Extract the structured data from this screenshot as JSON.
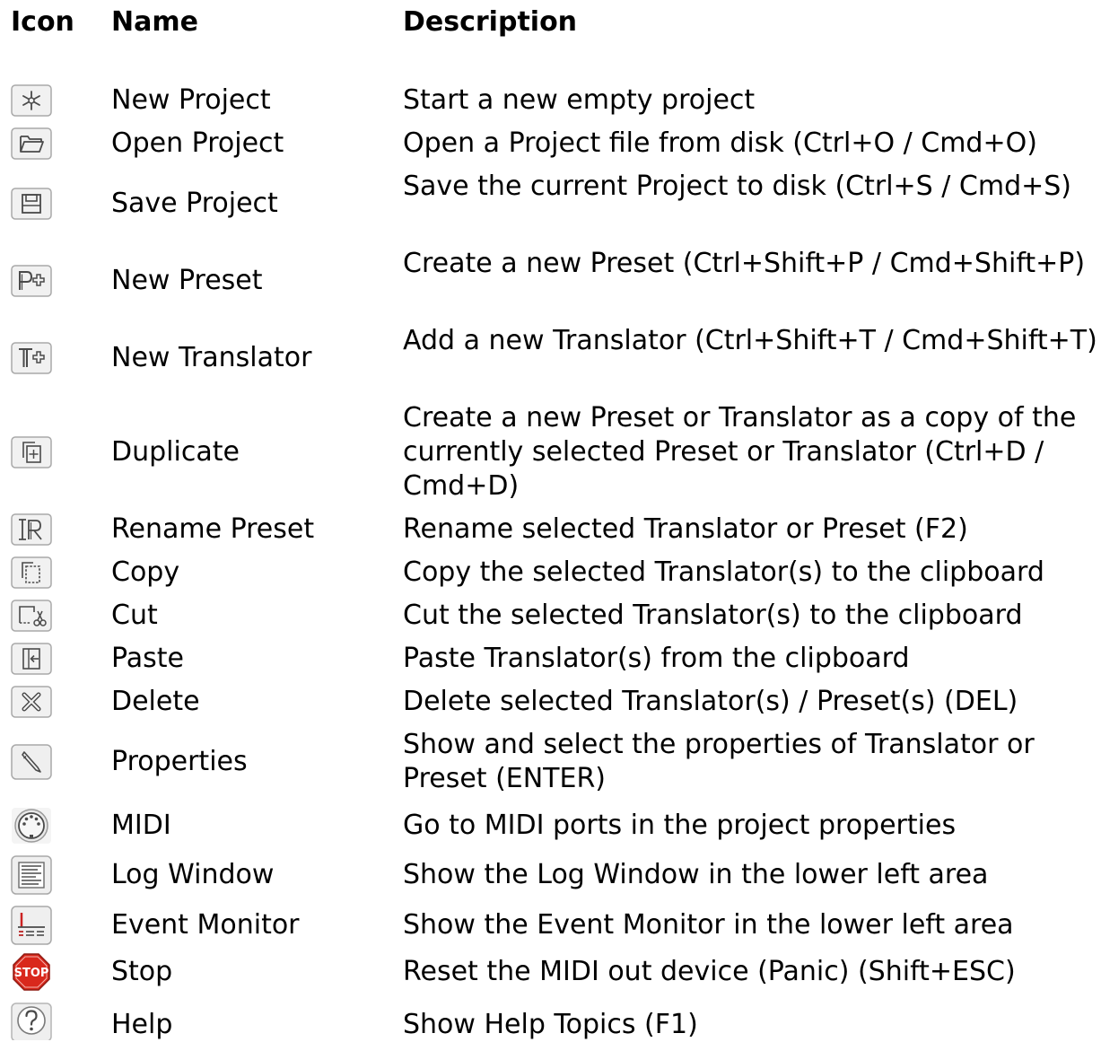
{
  "header": {
    "icon": "Icon",
    "name": "Name",
    "description": "Description"
  },
  "rows": [
    {
      "icon": "new-project-icon",
      "name": "New Project",
      "description": "Start a new empty project"
    },
    {
      "icon": "open-project-icon",
      "name": "Open Project",
      "description": "Open a Project file from disk (Ctrl+O / Cmd+O)"
    },
    {
      "icon": "save-project-icon",
      "name": "Save Project",
      "description": "Save the current Project to disk (Ctrl+S / Cmd+S)"
    },
    {
      "icon": "new-preset-icon",
      "name": "New Preset",
      "description": "Create a new Preset (Ctrl+Shift+P / Cmd+Shift+P)"
    },
    {
      "icon": "new-translator-icon",
      "name": "New Translator",
      "description": "Add a new Translator (Ctrl+Shift+T / Cmd+Shift+T)"
    },
    {
      "icon": "duplicate-icon",
      "name": "Duplicate",
      "description": "Create a new Preset or Translator as a copy of the currently selected Preset or Translator (Ctrl+D / Cmd+D)"
    },
    {
      "icon": "rename-icon",
      "name": "Rename Preset",
      "description": "Rename selected Translator or Preset (F2)"
    },
    {
      "icon": "copy-icon",
      "name": "Copy",
      "description": "Copy the selected Translator(s) to the clipboard"
    },
    {
      "icon": "cut-icon",
      "name": "Cut",
      "description": "Cut the selected Translator(s) to the clipboard"
    },
    {
      "icon": "paste-icon",
      "name": "Paste",
      "description": "Paste Translator(s) from the clipboard"
    },
    {
      "icon": "delete-icon",
      "name": "Delete",
      "description": "Delete selected Translator(s) / Preset(s) (DEL)"
    },
    {
      "icon": "properties-icon",
      "name": "Properties",
      "description": "Show and select the properties of Translator or Preset (ENTER)"
    },
    {
      "icon": "midi-icon",
      "name": "MIDI",
      "description": "Go to MIDI ports in the project properties"
    },
    {
      "icon": "log-window-icon",
      "name": "Log Window",
      "description": "Show the Log Window in the lower left area"
    },
    {
      "icon": "event-monitor-icon",
      "name": "Event Monitor",
      "description": "Show the Event Monitor in the lower left area"
    },
    {
      "icon": "stop-icon",
      "name": "Stop",
      "description": "Reset the MIDI out device (Panic) (Shift+ESC)",
      "icon_text": "STOP"
    },
    {
      "icon": "help-icon",
      "name": "Help",
      "description": "Show Help Topics (F1)"
    }
  ]
}
